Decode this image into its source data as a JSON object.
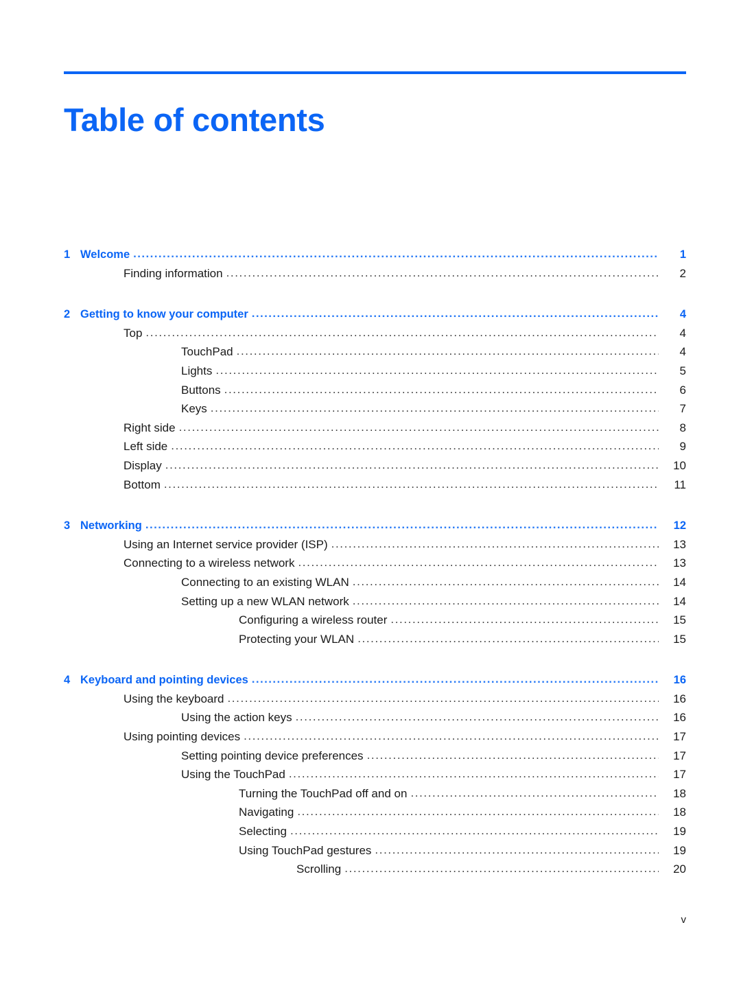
{
  "document": {
    "title": "Table of contents",
    "accent_color": "#0b65f5",
    "footer_page_label": "v"
  },
  "toc": {
    "entries": [
      {
        "level": 0,
        "number": "1",
        "text": "Welcome",
        "page": "1",
        "gap_before": false
      },
      {
        "level": 1,
        "number": "",
        "text": "Finding information",
        "page": "2",
        "gap_before": false
      },
      {
        "level": 0,
        "number": "2",
        "text": "Getting to know your computer",
        "page": "4",
        "gap_before": true
      },
      {
        "level": 1,
        "number": "",
        "text": "Top",
        "page": "4",
        "gap_before": false
      },
      {
        "level": 2,
        "number": "",
        "text": "TouchPad",
        "page": "4",
        "gap_before": false
      },
      {
        "level": 2,
        "number": "",
        "text": "Lights",
        "page": "5",
        "gap_before": false
      },
      {
        "level": 2,
        "number": "",
        "text": "Buttons",
        "page": "6",
        "gap_before": false
      },
      {
        "level": 2,
        "number": "",
        "text": "Keys",
        "page": "7",
        "gap_before": false
      },
      {
        "level": 1,
        "number": "",
        "text": "Right side",
        "page": "8",
        "gap_before": false
      },
      {
        "level": 1,
        "number": "",
        "text": "Left side",
        "page": "9",
        "gap_before": false
      },
      {
        "level": 1,
        "number": "",
        "text": "Display",
        "page": "10",
        "gap_before": false
      },
      {
        "level": 1,
        "number": "",
        "text": "Bottom",
        "page": "11",
        "gap_before": false
      },
      {
        "level": 0,
        "number": "3",
        "text": "Networking",
        "page": "12",
        "gap_before": true
      },
      {
        "level": 1,
        "number": "",
        "text": "Using an Internet service provider (ISP)",
        "page": "13",
        "gap_before": false
      },
      {
        "level": 1,
        "number": "",
        "text": "Connecting to a wireless network",
        "page": "13",
        "gap_before": false
      },
      {
        "level": 2,
        "number": "",
        "text": "Connecting to an existing WLAN",
        "page": "14",
        "gap_before": false
      },
      {
        "level": 2,
        "number": "",
        "text": "Setting up a new WLAN network",
        "page": "14",
        "gap_before": false
      },
      {
        "level": 3,
        "number": "",
        "text": "Configuring a wireless router",
        "page": "15",
        "gap_before": false
      },
      {
        "level": 3,
        "number": "",
        "text": "Protecting your WLAN",
        "page": "15",
        "gap_before": false
      },
      {
        "level": 0,
        "number": "4",
        "text": "Keyboard and pointing devices",
        "page": "16",
        "gap_before": true
      },
      {
        "level": 1,
        "number": "",
        "text": "Using the keyboard",
        "page": "16",
        "gap_before": false
      },
      {
        "level": 2,
        "number": "",
        "text": "Using the action keys",
        "page": "16",
        "gap_before": false
      },
      {
        "level": 1,
        "number": "",
        "text": "Using pointing devices",
        "page": "17",
        "gap_before": false
      },
      {
        "level": 2,
        "number": "",
        "text": "Setting pointing device preferences",
        "page": "17",
        "gap_before": false
      },
      {
        "level": 2,
        "number": "",
        "text": "Using the TouchPad",
        "page": "17",
        "gap_before": false
      },
      {
        "level": 3,
        "number": "",
        "text": "Turning the TouchPad off and on",
        "page": "18",
        "gap_before": false
      },
      {
        "level": 3,
        "number": "",
        "text": "Navigating",
        "page": "18",
        "gap_before": false
      },
      {
        "level": 3,
        "number": "",
        "text": "Selecting",
        "page": "19",
        "gap_before": false
      },
      {
        "level": 3,
        "number": "",
        "text": "Using TouchPad gestures",
        "page": "19",
        "gap_before": false
      },
      {
        "level": 4,
        "number": "",
        "text": "Scrolling",
        "page": "20",
        "gap_before": false
      }
    ]
  }
}
